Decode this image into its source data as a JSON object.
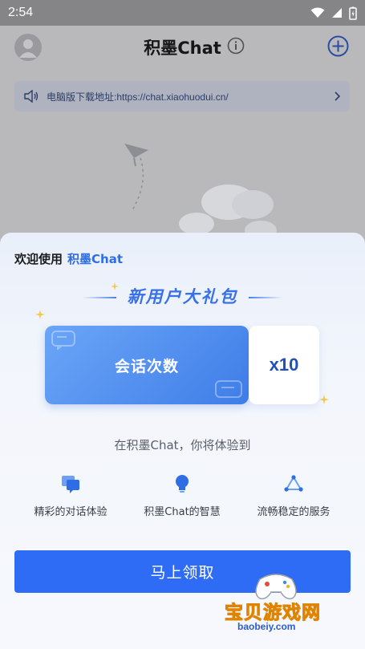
{
  "status_bar": {
    "time": "2:54"
  },
  "header": {
    "title": "积墨Chat"
  },
  "notice": {
    "text": "电脑版下载地址:https://chat.xiaohuodui.cn/"
  },
  "sheet": {
    "welcome_prefix": "欢迎使用",
    "welcome_brand": "积墨Chat",
    "gift_title": "新用户大礼包",
    "coupon_label": "会话次数",
    "coupon_count": "x10",
    "experience_text": "在积墨Chat，你将体验到",
    "features": [
      {
        "label": "精彩的对话体验",
        "icon": "chat-bubbles-icon"
      },
      {
        "label": "积墨Chat的智慧",
        "icon": "lightbulb-icon"
      },
      {
        "label": "流畅稳定的服务",
        "icon": "triangle-network-icon"
      }
    ],
    "claim_button": "马上领取"
  },
  "watermark": {
    "text": "宝贝游戏网",
    "url": "baobeiy.com"
  },
  "colors": {
    "accent": "#2e6cf5",
    "brand_text": "#2f6de6",
    "coupon_gradient_start": "#6aa6f7",
    "coupon_gradient_end": "#3f7de8"
  }
}
